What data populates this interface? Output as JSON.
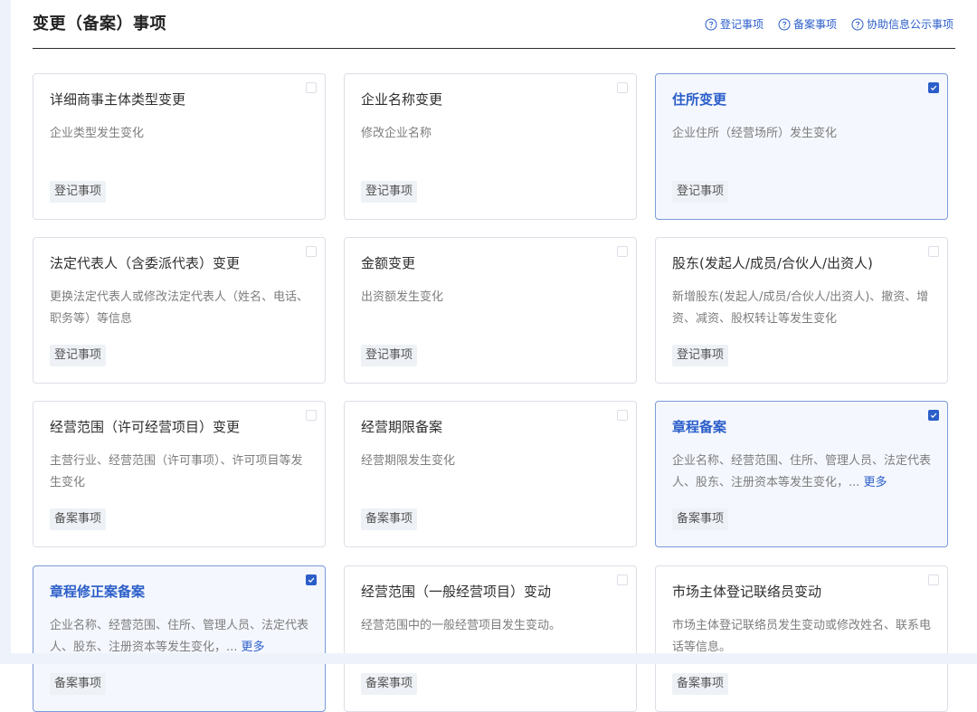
{
  "header": {
    "title": "变更（备案）事项",
    "links": [
      {
        "label": "登记事项",
        "icon": "question-circle-icon"
      },
      {
        "label": "备案事项",
        "icon": "question-circle-icon"
      },
      {
        "label": "协助信息公示事项",
        "icon": "question-circle-icon"
      }
    ]
  },
  "colors": {
    "accent": "#2b5ec9",
    "selected_bg": "#f4f7fd",
    "tag_bg": "#eef1f6"
  },
  "cards": [
    {
      "title": "详细商事主体类型变更",
      "desc": "企业类型发生变化",
      "more": "",
      "tag": "登记事项",
      "selected": false
    },
    {
      "title": "企业名称变更",
      "desc": "修改企业名称",
      "more": "",
      "tag": "登记事项",
      "selected": false
    },
    {
      "title": "住所变更",
      "desc": "企业住所（经营场所）发生变化",
      "more": "",
      "tag": "登记事项",
      "selected": true
    },
    {
      "title": "法定代表人（含委派代表）变更",
      "desc": "更换法定代表人或修改法定代表人（姓名、电话、职务等）等信息",
      "more": "",
      "tag": "登记事项",
      "selected": false
    },
    {
      "title": "金额变更",
      "desc": "出资额发生变化",
      "more": "",
      "tag": "登记事项",
      "selected": false
    },
    {
      "title": "股东(发起人/成员/合伙人/出资人)",
      "desc": "新增股东(发起人/成员/合伙人/出资人)、撤资、增资、减资、股权转让等发生变化",
      "more": "",
      "tag": "登记事项",
      "selected": false
    },
    {
      "title": "经营范围（许可经营项目）变更",
      "desc": "主营行业、经营范围（许可事项）、许可项目等发生变化",
      "more": "",
      "tag": "备案事项",
      "selected": false
    },
    {
      "title": "经营期限备案",
      "desc": "经营期限发生变化",
      "more": "",
      "tag": "备案事项",
      "selected": false
    },
    {
      "title": "章程备案",
      "desc": "企业名称、经营范围、住所、管理人员、法定代表人、股东、注册资本等发生变化，...",
      "more": "更多",
      "tag": "备案事项",
      "selected": true
    },
    {
      "title": "章程修正案备案",
      "desc": "企业名称、经营范围、住所、管理人员、法定代表人、股东、注册资本等发生变化，...",
      "more": "更多",
      "tag": "备案事项",
      "selected": true
    },
    {
      "title": "经营范围（一般经营项目）变动",
      "desc": "经营范围中的一般经营项目发生变动。",
      "more": "",
      "tag": "备案事项",
      "selected": false
    },
    {
      "title": "市场主体登记联络员变动",
      "desc": "市场主体登记联络员发生变动或修改姓名、联系电话等信息。",
      "more": "",
      "tag": "备案事项",
      "selected": false
    }
  ]
}
